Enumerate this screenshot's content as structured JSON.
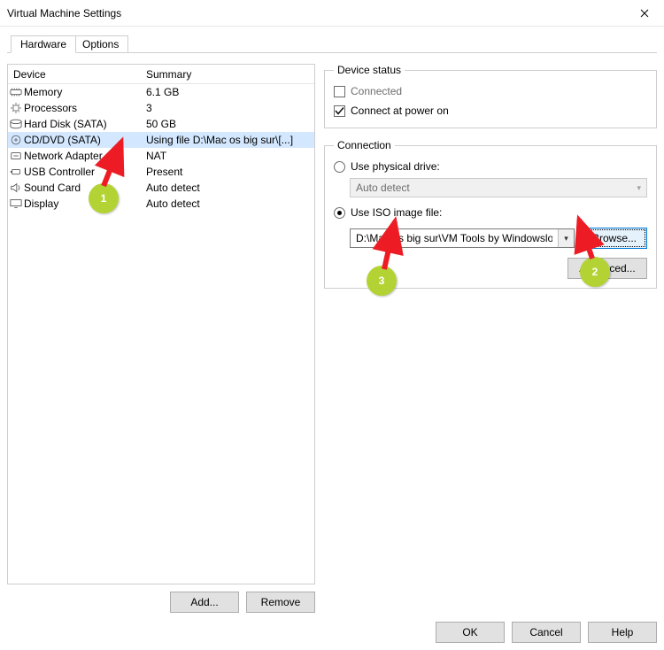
{
  "window": {
    "title": "Virtual Machine Settings"
  },
  "tabs": {
    "hardware": "Hardware",
    "options": "Options"
  },
  "columns": {
    "device": "Device",
    "summary": "Summary"
  },
  "devices": [
    {
      "icon": "memory-icon",
      "name": "Memory",
      "summary": "6.1 GB"
    },
    {
      "icon": "cpu-icon",
      "name": "Processors",
      "summary": "3"
    },
    {
      "icon": "disk-icon",
      "name": "Hard Disk (SATA)",
      "summary": "50 GB"
    },
    {
      "icon": "cd-icon",
      "name": "CD/DVD (SATA)",
      "summary": "Using file D:\\Mac os big sur\\[...]"
    },
    {
      "icon": "net-icon",
      "name": "Network Adapter",
      "summary": "NAT"
    },
    {
      "icon": "usb-icon",
      "name": "USB Controller",
      "summary": "Present"
    },
    {
      "icon": "sound-icon",
      "name": "Sound Card",
      "summary": "Auto detect"
    },
    {
      "icon": "display-icon",
      "name": "Display",
      "summary": "Auto detect"
    }
  ],
  "selectedIndex": 3,
  "left_buttons": {
    "add": "Add...",
    "remove": "Remove"
  },
  "device_status": {
    "legend": "Device status",
    "connected": "Connected",
    "connect_power": "Connect at power on",
    "connected_checked": false,
    "connect_power_checked": true
  },
  "connection": {
    "legend": "Connection",
    "use_physical": "Use physical drive:",
    "physical_value": "Auto detect",
    "use_iso": "Use ISO image file:",
    "iso_value": "D:\\Mac os big sur\\VM Tools by Windowslovers.com.i",
    "selected": "iso",
    "browse": "Browse...",
    "advanced": "Advanced..."
  },
  "bottom": {
    "ok": "OK",
    "cancel": "Cancel",
    "help": "Help"
  },
  "annotations": {
    "n1": "1",
    "n2": "2",
    "n3": "3"
  }
}
